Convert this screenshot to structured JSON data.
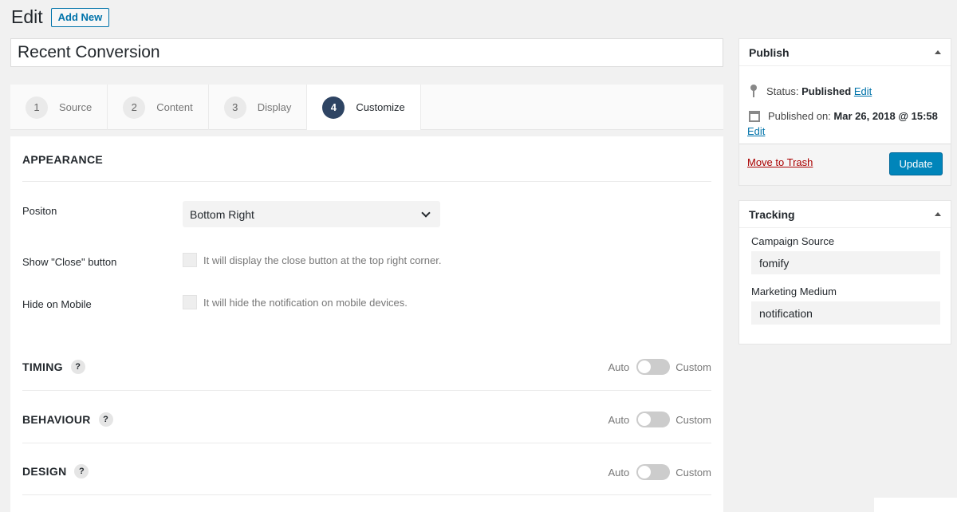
{
  "header": {
    "title": "Edit",
    "add_new": "Add New"
  },
  "post_title": "Recent Conversion",
  "steps": [
    {
      "num": "1",
      "label": "Source"
    },
    {
      "num": "2",
      "label": "Content"
    },
    {
      "num": "3",
      "label": "Display"
    },
    {
      "num": "4",
      "label": "Customize",
      "active": true
    }
  ],
  "appearance": {
    "heading": "APPEARANCE",
    "position_label": "Positon",
    "position_value": "Bottom Right",
    "close_label": "Show \"Close\" button",
    "close_desc": "It will display the close button at the top right corner.",
    "mobile_label": "Hide on Mobile",
    "mobile_desc": "It will hide the notification on mobile devices."
  },
  "sections": [
    {
      "heading": "TIMING",
      "help": "?",
      "auto": "Auto",
      "custom": "Custom"
    },
    {
      "heading": "BEHAVIOUR",
      "help": "?",
      "auto": "Auto",
      "custom": "Custom"
    },
    {
      "heading": "DESIGN",
      "help": "?",
      "auto": "Auto",
      "custom": "Custom"
    }
  ],
  "publish": {
    "title": "Publish",
    "status_label": "Status:",
    "status_value": "Published",
    "edit": "Edit",
    "published_on_label": "Published on:",
    "published_on_value": "Mar 26, 2018 @ 15:58",
    "trash": "Move to Trash",
    "update": "Update"
  },
  "tracking": {
    "title": "Tracking",
    "source_label": "Campaign Source",
    "source_value": "fomify",
    "medium_label": "Marketing Medium",
    "medium_value": "notification"
  },
  "colors": {
    "primary": "#0085ba",
    "active_step": "#2e4463",
    "link": "#0073aa",
    "trash": "#a00"
  }
}
